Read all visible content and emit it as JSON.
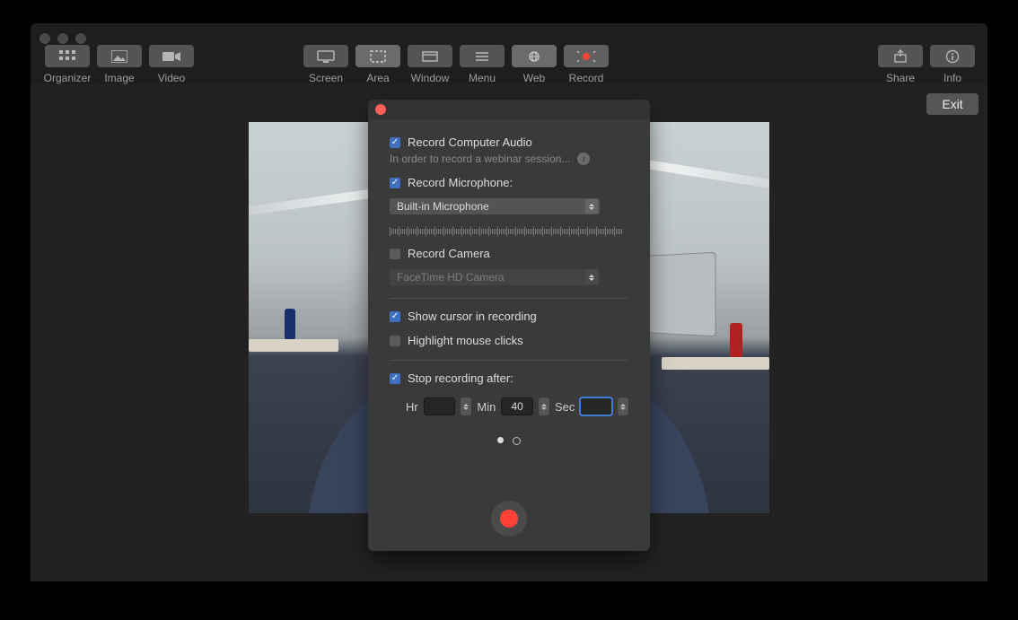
{
  "toolbar": {
    "left": [
      {
        "id": "organizer",
        "label": "Organizer"
      },
      {
        "id": "image",
        "label": "Image"
      },
      {
        "id": "video",
        "label": "Video"
      }
    ],
    "mid": [
      {
        "id": "screen",
        "label": "Screen"
      },
      {
        "id": "area",
        "label": "Area"
      },
      {
        "id": "window",
        "label": "Window"
      },
      {
        "id": "menu",
        "label": "Menu"
      },
      {
        "id": "web",
        "label": "Web"
      },
      {
        "id": "record",
        "label": "Record"
      }
    ],
    "right": [
      {
        "id": "share",
        "label": "Share"
      },
      {
        "id": "info",
        "label": "Info"
      }
    ],
    "exit_label": "Exit"
  },
  "popover": {
    "record_audio_label": "Record Computer Audio",
    "audio_hint": "In order to record a webinar session...",
    "record_mic_label": "Record Microphone:",
    "mic_options": [
      "Built-in Microphone"
    ],
    "mic_selected": "Built-in Microphone",
    "record_camera_label": "Record Camera",
    "camera_selected": "FaceTime HD Camera",
    "show_cursor_label": "Show cursor in recording",
    "highlight_clicks_label": "Highlight mouse clicks",
    "stop_after_label": "Stop recording after:",
    "timer": {
      "hr_label": "Hr",
      "hr_value": "",
      "min_label": "Min",
      "min_value": "40",
      "sec_label": "Sec",
      "sec_value": ""
    },
    "checks": {
      "audio": true,
      "mic": true,
      "camera": false,
      "cursor": true,
      "highlight": false,
      "stop_after": true
    },
    "page_dots": {
      "total": 2,
      "current": 1
    }
  }
}
